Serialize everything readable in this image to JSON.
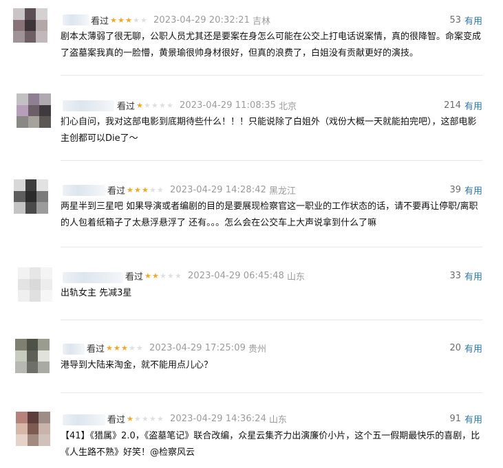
{
  "vote_label": "有用",
  "reviews": [
    {
      "status": "看过",
      "rating": 3,
      "time": "2023-04-29 20:32:21",
      "location": "吉林",
      "votes": "53",
      "text": "剧本太薄弱了很无聊，公职人员尤其还是要案在身怎么可能在公交上打电话说案情，真的很降智。命案变成了盗墓案我真的一脸懵，黄景瑜很帅身材很好，但真的浪费了，白姐没有贡献更好的演技。"
    },
    {
      "status": "看过",
      "rating": 1,
      "time": "2023-04-29 11:08:35",
      "location": "北京",
      "votes": "214",
      "text": "扪心自问，我对这部电影到底期待些什么！！！只能说除了白姐外（戏份大概一天就能拍完吧），这部电影主创都可以Die了～"
    },
    {
      "status": "看过",
      "rating": 3,
      "time": "2023-04-29 14:28:42",
      "location": "黑龙江",
      "votes": "39",
      "text": "两星半到三星吧 如果导演或者编剧的目的是要展现检察官这一职业的工作状态的话，请不要再让停职/离职的人包着纸箱子了太悬浮悬浮了 还有。。。怎么会在公交车上大声说拿到什么了嘛"
    },
    {
      "status": "看过",
      "rating": 2,
      "time": "2023-04-29 06:45:48",
      "location": "山东",
      "votes": "33",
      "text": "出轨女主 先减3星"
    },
    {
      "status": "看过",
      "rating": 3,
      "time": "2023-04-29 17:25:09",
      "location": "贵州",
      "votes": "20",
      "text": "港导到大陆来淘金，就不能用点儿心？"
    },
    {
      "status": "看过",
      "rating": 1,
      "time": "2023-04-29 14:36:24",
      "location": "山东",
      "votes": "91",
      "text": "【41】《猎属》2.0，《盗墓笔记》联合改编，众星云集齐力出演廉价小片，这个五一假期最快乐的喜剧，比《人生路不熟》好笑！@检察风云"
    }
  ]
}
